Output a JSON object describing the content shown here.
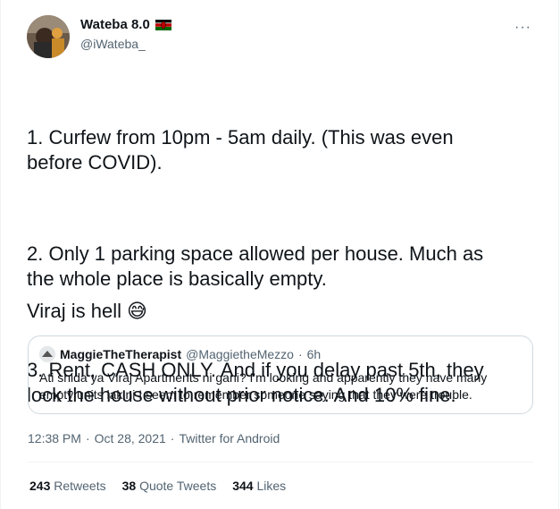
{
  "author": {
    "display_name": "Wateba 8.0",
    "handle": "@iWateba_",
    "flag_icon": "kenya-flag-icon"
  },
  "tweet": {
    "paragraphs": [
      "1. Curfew from 10pm - 5am daily. (This was even\nbefore COVID).",
      "2. Only 1 parking space allowed per house. Much as\nthe whole place is basically empty.",
      "3. Rent, CASH ONLY. And if you delay past 5th, they\nlock the house without prior notice. And 10% fine."
    ],
    "closing": "Viraj is hell",
    "emoji": "😅"
  },
  "quoted": {
    "display_name": "MaggieTheTherapist",
    "handle": "@MaggietheMezzo",
    "dot": "·",
    "time": "6h",
    "text": "Ati shida ya Viraj Apartments ni gani? I'm looking and apparently they have many empty units lakini I seem to remember someone saying that they were trouble."
  },
  "meta": {
    "time": "12:38 PM",
    "date": "Oct 28, 2021",
    "source": "Twitter for Android",
    "sep": "·"
  },
  "stats": {
    "retweets_count": "243",
    "retweets_label": "Retweets",
    "quotes_count": "38",
    "quotes_label": "Quote Tweets",
    "likes_count": "344",
    "likes_label": "Likes"
  },
  "more_label": "···",
  "colors": {
    "text": "#0f1419",
    "secondary": "#536471",
    "border": "#cfd9de"
  }
}
